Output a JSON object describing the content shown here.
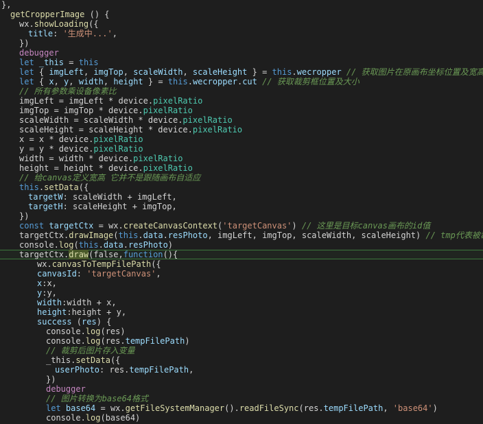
{
  "editor": {
    "language": "javascript",
    "highlighted_line_index": 26,
    "lines": [
      {
        "indent": 0,
        "tokens": [
          {
            "t": "},",
            "c": "txt"
          }
        ]
      },
      {
        "indent": 1,
        "tokens": [
          {
            "t": "getCropperImage",
            "c": "fn"
          },
          {
            "t": " () {",
            "c": "txt"
          }
        ]
      },
      {
        "indent": 2,
        "tokens": [
          {
            "t": "wx",
            "c": "txt"
          },
          {
            "t": ".",
            "c": "txt"
          },
          {
            "t": "showLoading",
            "c": "fn"
          },
          {
            "t": "({",
            "c": "txt"
          }
        ]
      },
      {
        "indent": 3,
        "tokens": [
          {
            "t": "title",
            "c": "var"
          },
          {
            "t": ": ",
            "c": "txt"
          },
          {
            "t": "'生成中...'",
            "c": "str"
          },
          {
            "t": ",",
            "c": "txt"
          }
        ]
      },
      {
        "indent": 2,
        "tokens": [
          {
            "t": "})",
            "c": "txt"
          }
        ]
      },
      {
        "indent": 2,
        "tokens": [
          {
            "t": "debugger",
            "c": "ctl"
          }
        ]
      },
      {
        "indent": 2,
        "tokens": [
          {
            "t": "let ",
            "c": "kw"
          },
          {
            "t": "_this",
            "c": "var"
          },
          {
            "t": " = ",
            "c": "txt"
          },
          {
            "t": "this",
            "c": "kw"
          }
        ]
      },
      {
        "indent": 2,
        "tokens": [
          {
            "t": "let ",
            "c": "kw"
          },
          {
            "t": "{ ",
            "c": "txt"
          },
          {
            "t": "imgLeft",
            "c": "var"
          },
          {
            "t": ", ",
            "c": "txt"
          },
          {
            "t": "imgTop",
            "c": "var"
          },
          {
            "t": ", ",
            "c": "txt"
          },
          {
            "t": "scaleWidth",
            "c": "var"
          },
          {
            "t": ", ",
            "c": "txt"
          },
          {
            "t": "scaleHeight",
            "c": "var"
          },
          {
            "t": " } = ",
            "c": "txt"
          },
          {
            "t": "this",
            "c": "kw"
          },
          {
            "t": ".",
            "c": "txt"
          },
          {
            "t": "wecropper",
            "c": "var"
          },
          {
            "t": " // 获取图片在原画布坐标位置及宽高",
            "c": "cm"
          }
        ]
      },
      {
        "indent": 2,
        "tokens": [
          {
            "t": "let ",
            "c": "kw"
          },
          {
            "t": "{ ",
            "c": "txt"
          },
          {
            "t": "x",
            "c": "var"
          },
          {
            "t": ", ",
            "c": "txt"
          },
          {
            "t": "y",
            "c": "var"
          },
          {
            "t": ", ",
            "c": "txt"
          },
          {
            "t": "width",
            "c": "var"
          },
          {
            "t": ", ",
            "c": "txt"
          },
          {
            "t": "height",
            "c": "var"
          },
          {
            "t": " } = ",
            "c": "txt"
          },
          {
            "t": "this",
            "c": "kw"
          },
          {
            "t": ".",
            "c": "txt"
          },
          {
            "t": "wecropper",
            "c": "var"
          },
          {
            "t": ".",
            "c": "txt"
          },
          {
            "t": "cut",
            "c": "var"
          },
          {
            "t": " // 获取裁剪框位置及大小",
            "c": "cm"
          }
        ]
      },
      {
        "indent": 2,
        "tokens": [
          {
            "t": "// 所有参数乘设备像素比",
            "c": "cm"
          }
        ]
      },
      {
        "indent": 2,
        "tokens": [
          {
            "t": "imgLeft = imgLeft * device.",
            "c": "txt"
          },
          {
            "t": "pixelRatio",
            "c": "prop"
          }
        ]
      },
      {
        "indent": 2,
        "tokens": [
          {
            "t": "imgTop = imgTop * device.",
            "c": "txt"
          },
          {
            "t": "pixelRatio",
            "c": "prop"
          }
        ]
      },
      {
        "indent": 2,
        "tokens": [
          {
            "t": "scaleWidth = scaleWidth * device.",
            "c": "txt"
          },
          {
            "t": "pixelRatio",
            "c": "prop"
          }
        ]
      },
      {
        "indent": 2,
        "tokens": [
          {
            "t": "scaleHeight = scaleHeight * device.",
            "c": "txt"
          },
          {
            "t": "pixelRatio",
            "c": "prop"
          }
        ]
      },
      {
        "indent": 2,
        "tokens": [
          {
            "t": "x = x * device.",
            "c": "txt"
          },
          {
            "t": "pixelRatio",
            "c": "prop"
          }
        ]
      },
      {
        "indent": 2,
        "tokens": [
          {
            "t": "y = y * device.",
            "c": "txt"
          },
          {
            "t": "pixelRatio",
            "c": "prop"
          }
        ]
      },
      {
        "indent": 2,
        "tokens": [
          {
            "t": "width = width * device.",
            "c": "txt"
          },
          {
            "t": "pixelRatio",
            "c": "prop"
          }
        ]
      },
      {
        "indent": 2,
        "tokens": [
          {
            "t": "height = height * device.",
            "c": "txt"
          },
          {
            "t": "pixelRatio",
            "c": "prop"
          }
        ]
      },
      {
        "indent": 2,
        "tokens": [
          {
            "t": "// 给canvas定义宽高 它并不是跟随画布自适应",
            "c": "cm"
          }
        ]
      },
      {
        "indent": 2,
        "tokens": [
          {
            "t": "this",
            "c": "kw"
          },
          {
            "t": ".",
            "c": "txt"
          },
          {
            "t": "setData",
            "c": "fn"
          },
          {
            "t": "({",
            "c": "txt"
          }
        ]
      },
      {
        "indent": 3,
        "tokens": [
          {
            "t": "targetW",
            "c": "var"
          },
          {
            "t": ": scaleWidth + imgLeft,",
            "c": "txt"
          }
        ]
      },
      {
        "indent": 3,
        "tokens": [
          {
            "t": "targetH",
            "c": "var"
          },
          {
            "t": ": scaleHeight + imgTop,",
            "c": "txt"
          }
        ]
      },
      {
        "indent": 2,
        "tokens": [
          {
            "t": "})",
            "c": "txt"
          }
        ]
      },
      {
        "indent": 2,
        "tokens": [
          {
            "t": "const ",
            "c": "kw"
          },
          {
            "t": "targetCtx",
            "c": "var"
          },
          {
            "t": " = wx.",
            "c": "txt"
          },
          {
            "t": "createCanvasContext",
            "c": "fn"
          },
          {
            "t": "(",
            "c": "txt"
          },
          {
            "t": "'targetCanvas'",
            "c": "str"
          },
          {
            "t": ") ",
            "c": "txt"
          },
          {
            "t": "// 这里是目标canvas画布的id值",
            "c": "cm"
          }
        ]
      },
      {
        "indent": 2,
        "tokens": [
          {
            "t": "targetCtx.",
            "c": "txt"
          },
          {
            "t": "drawImage",
            "c": "fn"
          },
          {
            "t": "(",
            "c": "txt"
          },
          {
            "t": "this",
            "c": "kw"
          },
          {
            "t": ".",
            "c": "txt"
          },
          {
            "t": "data",
            "c": "var"
          },
          {
            "t": ".",
            "c": "txt"
          },
          {
            "t": "resPhoto",
            "c": "var"
          },
          {
            "t": ", imgLeft, imgTop, scaleWidth, scaleHeight) ",
            "c": "txt"
          },
          {
            "t": "// tmp代表被裁剪图片的",
            "c": "cm"
          }
        ]
      },
      {
        "indent": 2,
        "tokens": [
          {
            "t": "console.",
            "c": "txt"
          },
          {
            "t": "log",
            "c": "fn"
          },
          {
            "t": "(",
            "c": "txt"
          },
          {
            "t": "this",
            "c": "kw"
          },
          {
            "t": ".",
            "c": "txt"
          },
          {
            "t": "data",
            "c": "var"
          },
          {
            "t": ".",
            "c": "txt"
          },
          {
            "t": "resPhoto",
            "c": "var"
          },
          {
            "t": ")",
            "c": "txt"
          }
        ]
      },
      {
        "indent": 2,
        "tokens": [
          {
            "t": "targetCtx.",
            "c": "txt"
          },
          {
            "t": "draw",
            "c": "fn",
            "mark": true
          },
          {
            "t": "(false,",
            "c": "txt"
          },
          {
            "t": "function",
            "c": "kw"
          },
          {
            "t": "(){",
            "c": "txt"
          }
        ]
      },
      {
        "indent": 4,
        "tokens": [
          {
            "t": "wx.",
            "c": "txt"
          },
          {
            "t": "canvasToTempFilePath",
            "c": "fn"
          },
          {
            "t": "({",
            "c": "txt"
          }
        ]
      },
      {
        "indent": 4,
        "tokens": [
          {
            "t": "canvasId",
            "c": "var"
          },
          {
            "t": ": ",
            "c": "txt"
          },
          {
            "t": "'targetCanvas'",
            "c": "str"
          },
          {
            "t": ",",
            "c": "txt"
          }
        ]
      },
      {
        "indent": 4,
        "tokens": [
          {
            "t": "x",
            "c": "var"
          },
          {
            "t": ":x,",
            "c": "txt"
          }
        ]
      },
      {
        "indent": 4,
        "tokens": [
          {
            "t": "y",
            "c": "var"
          },
          {
            "t": ":y,",
            "c": "txt"
          }
        ]
      },
      {
        "indent": 4,
        "tokens": [
          {
            "t": "width",
            "c": "var"
          },
          {
            "t": ":width + x,",
            "c": "txt"
          }
        ]
      },
      {
        "indent": 4,
        "tokens": [
          {
            "t": "height",
            "c": "var"
          },
          {
            "t": ":height + y,",
            "c": "txt"
          }
        ]
      },
      {
        "indent": 4,
        "tokens": [
          {
            "t": "success",
            "c": "var"
          },
          {
            "t": " (",
            "c": "txt"
          },
          {
            "t": "res",
            "c": "var"
          },
          {
            "t": ") {",
            "c": "txt"
          }
        ]
      },
      {
        "indent": 5,
        "tokens": [
          {
            "t": "console.",
            "c": "txt"
          },
          {
            "t": "log",
            "c": "fn"
          },
          {
            "t": "(res)",
            "c": "txt"
          }
        ]
      },
      {
        "indent": 5,
        "tokens": [
          {
            "t": "console.",
            "c": "txt"
          },
          {
            "t": "log",
            "c": "fn"
          },
          {
            "t": "(res.",
            "c": "txt"
          },
          {
            "t": "tempFilePath",
            "c": "var"
          },
          {
            "t": ")",
            "c": "txt"
          }
        ]
      },
      {
        "indent": 5,
        "tokens": [
          {
            "t": "// 裁剪后图片存入变量",
            "c": "cm"
          }
        ]
      },
      {
        "indent": 5,
        "tokens": [
          {
            "t": "_this.",
            "c": "txt"
          },
          {
            "t": "setData",
            "c": "fn"
          },
          {
            "t": "({",
            "c": "txt"
          }
        ]
      },
      {
        "indent": 6,
        "tokens": [
          {
            "t": "userPhoto",
            "c": "var"
          },
          {
            "t": ": res.",
            "c": "txt"
          },
          {
            "t": "tempFilePath",
            "c": "var"
          },
          {
            "t": ",",
            "c": "txt"
          }
        ]
      },
      {
        "indent": 5,
        "tokens": [
          {
            "t": "})",
            "c": "txt"
          }
        ]
      },
      {
        "indent": 5,
        "tokens": [
          {
            "t": "debugger",
            "c": "ctl"
          }
        ]
      },
      {
        "indent": 5,
        "tokens": [
          {
            "t": "// 图片转换为base64格式",
            "c": "cm"
          }
        ]
      },
      {
        "indent": 5,
        "tokens": [
          {
            "t": "let ",
            "c": "kw"
          },
          {
            "t": "base64",
            "c": "var"
          },
          {
            "t": " = wx.",
            "c": "txt"
          },
          {
            "t": "getFileSystemManager",
            "c": "fn"
          },
          {
            "t": "().",
            "c": "txt"
          },
          {
            "t": "readFileSync",
            "c": "fn"
          },
          {
            "t": "(res.",
            "c": "txt"
          },
          {
            "t": "tempFilePath",
            "c": "var"
          },
          {
            "t": ", ",
            "c": "txt"
          },
          {
            "t": "'base64'",
            "c": "str"
          },
          {
            "t": ")",
            "c": "txt"
          }
        ]
      },
      {
        "indent": 5,
        "tokens": [
          {
            "t": "console.",
            "c": "txt"
          },
          {
            "t": "log",
            "c": "fn"
          },
          {
            "t": "(base64)",
            "c": "txt"
          }
        ]
      }
    ]
  }
}
